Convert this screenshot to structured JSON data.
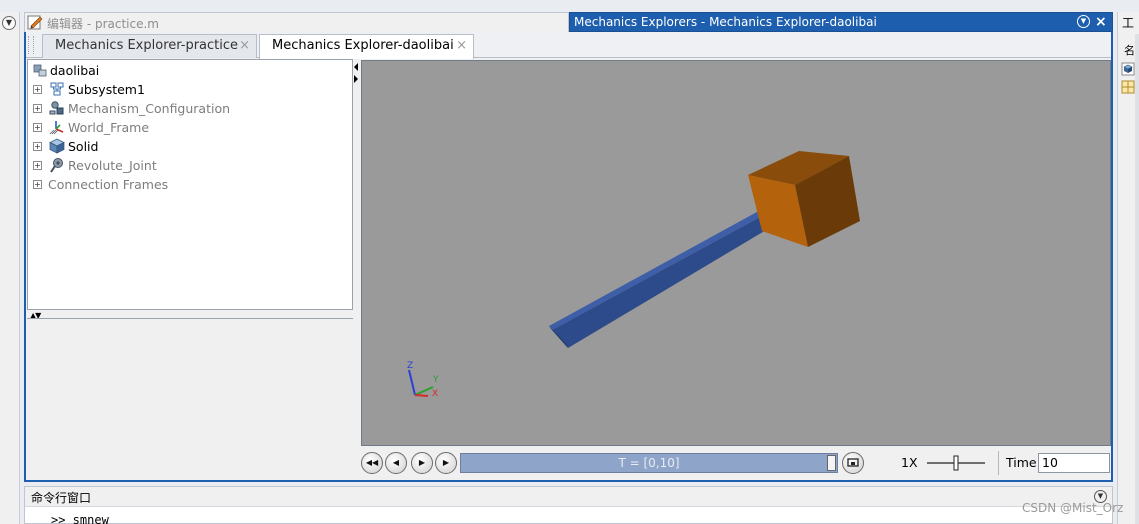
{
  "editor": {
    "title": "编辑器 - practice.m"
  },
  "explorer": {
    "title": "Mechanics Explorers - Mechanics Explorer-daolibai",
    "tabs": [
      {
        "label": "Mechanics Explorer-practice",
        "active": false
      },
      {
        "label": "Mechanics Explorer-daolibai",
        "active": true
      }
    ],
    "tab_close_glyph": "×"
  },
  "tree": {
    "root": {
      "label": "daolibai",
      "icon": "model-icon"
    },
    "items": [
      {
        "label": "Subsystem1",
        "icon": "subsystem-icon",
        "active": true
      },
      {
        "label": "Mechanism_Configuration",
        "icon": "mechanism-config-icon",
        "active": false
      },
      {
        "label": "World_Frame",
        "icon": "frame-icon",
        "active": false
      },
      {
        "label": "Solid",
        "icon": "solid-cube-icon",
        "active": true
      },
      {
        "label": "Revolute_Joint",
        "icon": "revolute-joint-icon",
        "active": false
      },
      {
        "label": "Connection Frames",
        "icon": "",
        "active": false
      }
    ]
  },
  "viewport": {
    "background": "#9a9a9a",
    "pendulum_rod_color": "#2d4a8a",
    "pendulum_mass_color": "#b5620c",
    "triad": {
      "z": "Z",
      "y": "Y",
      "x": "X"
    }
  },
  "playback": {
    "progress_text": "T = [0,10]",
    "progress": 1.0,
    "speed_label": "1X",
    "time_label": "Time",
    "time_value": "10"
  },
  "workspace_strip": {
    "title": "工",
    "subtitle": "名"
  },
  "command_window": {
    "title": "命令行窗口",
    "prompt": ">> smnew"
  },
  "watermark": "CSDN @Mist_Orz",
  "colors": {
    "title_active": "#1d5fae",
    "progress_fill": "#8fa4c9"
  }
}
